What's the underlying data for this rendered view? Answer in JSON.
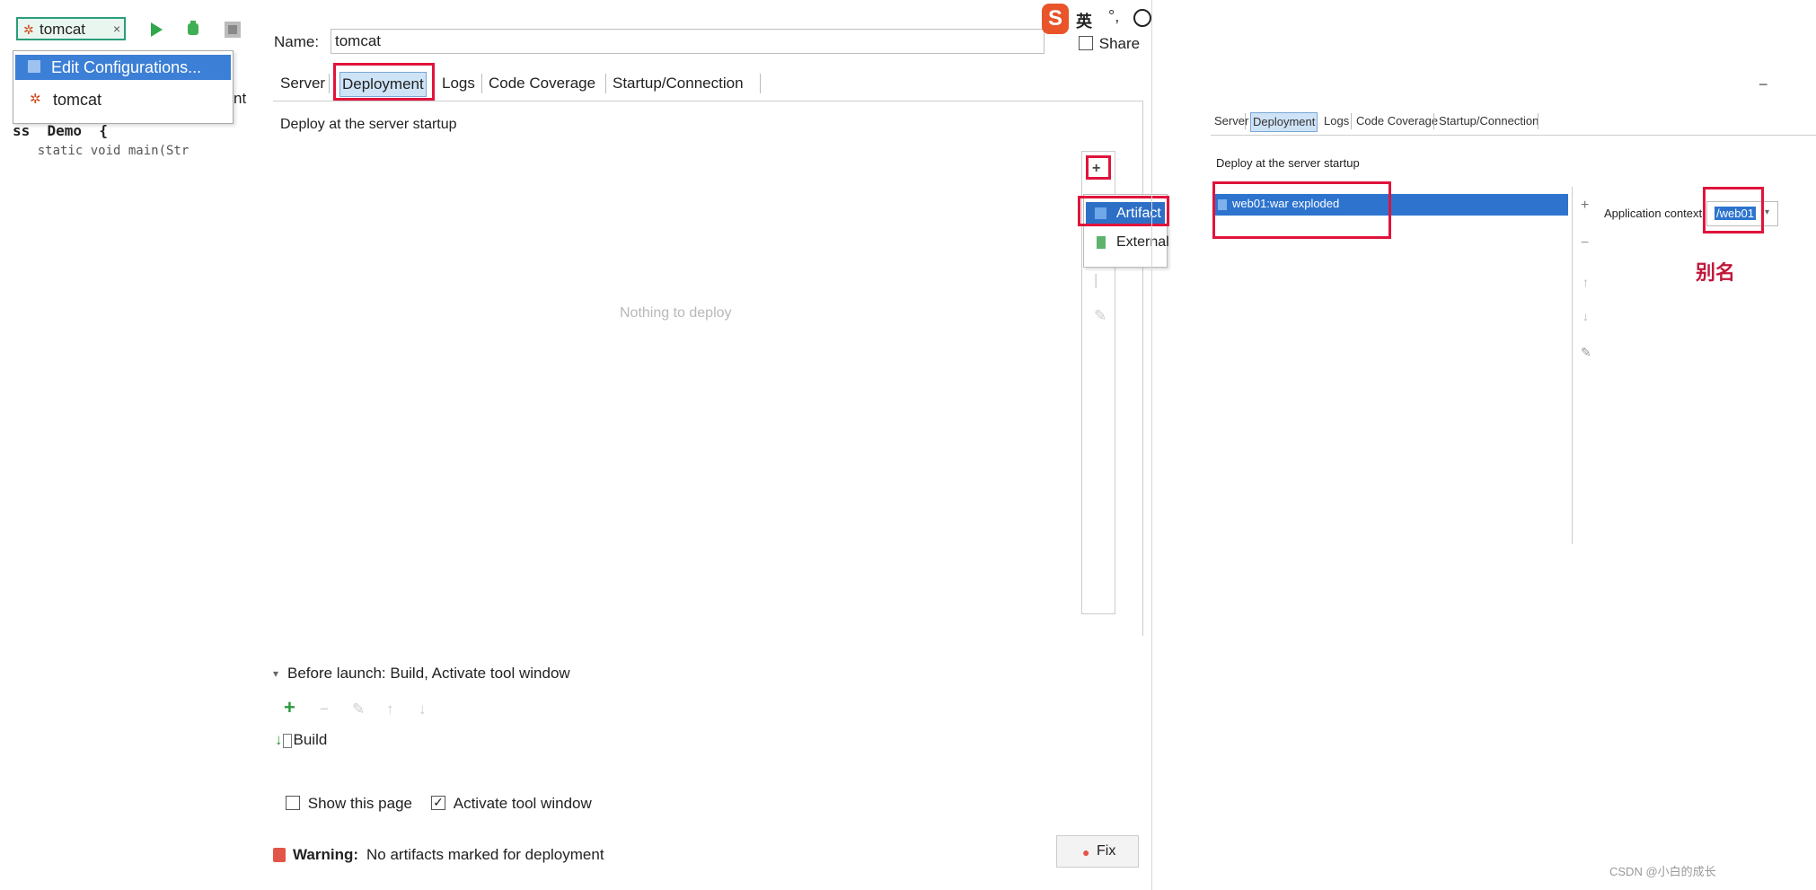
{
  "toolbar": {
    "run_config": "tomcat",
    "dropdown_arrow": "×",
    "run_icon": "run-icon",
    "debug_icon": "debug-icon",
    "coverage_icon": "coverage-icon"
  },
  "run_menu": {
    "edit_configurations": "Edit Configurations...",
    "tomcat_item": "tomcat",
    "partial_text": "nt"
  },
  "editor": {
    "line1": "ss  Demo  {",
    "line2": "    static void main(Str"
  },
  "dialog": {
    "name_label": "Name:",
    "name_value": "tomcat",
    "share_label": "Share",
    "tabs": [
      "Server",
      "Deployment",
      "Logs",
      "Code Coverage",
      "Startup/Connection"
    ],
    "deploy_label": "Deploy at the server startup",
    "empty_text": "Nothing to deploy",
    "add_button": "+",
    "add_menu": [
      "Artifact",
      "External"
    ],
    "before_launch": "Before launch: Build, Activate tool window",
    "build_item": "Build",
    "show_page_label": "Show this page",
    "activate_tool_label": "Activate tool window",
    "warning_label": "Warning:",
    "warning_text": "No artifacts marked for deployment",
    "fix_button": "Fix"
  },
  "ime": {
    "logo": "S",
    "lang": "英"
  },
  "right_panel": {
    "tabs": [
      "Server",
      "Deployment",
      "Logs",
      "Code Coverage",
      "Startup/Connection"
    ],
    "deploy_label": "Deploy at the server startup",
    "artifact_item": "web01:war exploded",
    "app_context_label": "Application context:",
    "app_context_value": "/web01",
    "alias_note": "别名",
    "side_buttons": [
      "+",
      "−",
      "↑",
      "↓",
      "✎"
    ]
  },
  "watermark": "CSDN @小白的成长"
}
